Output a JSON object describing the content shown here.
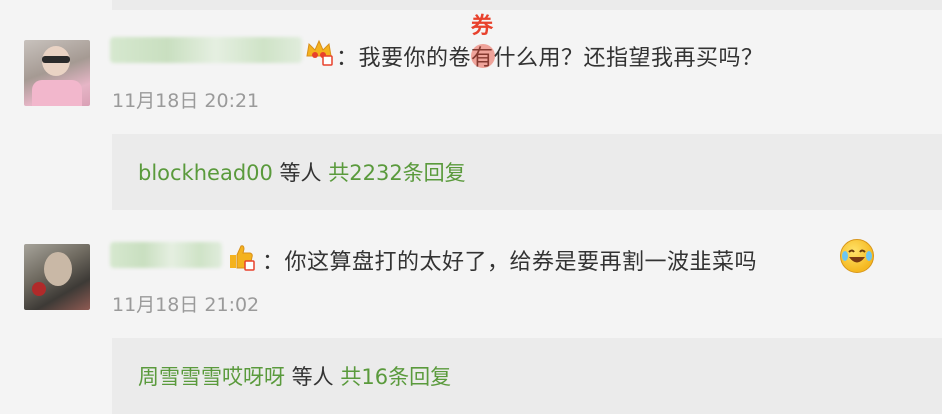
{
  "comments": [
    {
      "text_before": "：我要你的",
      "highlight_char": "卷",
      "overlay_char": "券",
      "text_after": "有什么用？还指望我再买吗？",
      "timestamp": "11月18日 20:21",
      "reply_user": "blockhead00",
      "reply_mid": " 等人 ",
      "reply_count": "共2232条回复",
      "badge_icon": "crown-vip-icon"
    },
    {
      "text": "：你这算盘打的太好了，给券是要再割一波韭菜吗",
      "emoji_icon": "laughing-tears-emoji-icon",
      "timestamp": "11月18日 21:02",
      "reply_user": "周雪雪雪哎呀呀",
      "reply_mid": " 等人 ",
      "reply_count": "共16条回复",
      "badge_icon": "thumb-vip-icon"
    }
  ],
  "colors": {
    "accent_green": "#5a9a3c",
    "highlight_red": "#e8412c"
  }
}
